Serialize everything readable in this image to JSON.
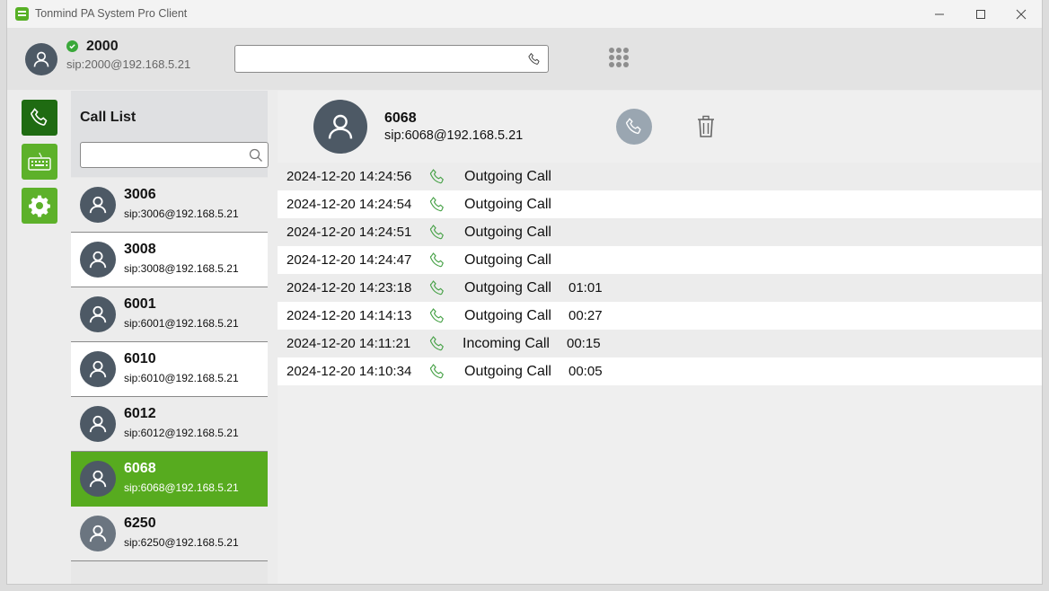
{
  "window": {
    "title": "Tonmind PA System Pro Client"
  },
  "header": {
    "user_name": "2000",
    "user_sip": "sip:2000@192.168.5.21",
    "dial_placeholder": ""
  },
  "call_list": {
    "title": "Call List",
    "search_placeholder": "",
    "contacts": [
      {
        "name": "3006",
        "sip": "sip:3006@192.168.5.21"
      },
      {
        "name": "3008",
        "sip": "sip:3008@192.168.5.21"
      },
      {
        "name": "6001",
        "sip": "sip:6001@192.168.5.21"
      },
      {
        "name": "6010",
        "sip": "sip:6010@192.168.5.21"
      },
      {
        "name": "6012",
        "sip": "sip:6012@192.168.5.21"
      },
      {
        "name": "6068",
        "sip": "sip:6068@192.168.5.21"
      },
      {
        "name": "6250",
        "sip": "sip:6250@192.168.5.21"
      }
    ]
  },
  "detail": {
    "name": "6068",
    "sip": "sip:6068@192.168.5.21",
    "history": [
      {
        "date": "2024-12-20 14:24:56",
        "type": "Outgoing Call",
        "duration": ""
      },
      {
        "date": "2024-12-20 14:24:54",
        "type": "Outgoing Call",
        "duration": ""
      },
      {
        "date": "2024-12-20 14:24:51",
        "type": "Outgoing Call",
        "duration": ""
      },
      {
        "date": "2024-12-20 14:24:47",
        "type": "Outgoing Call",
        "duration": ""
      },
      {
        "date": "2024-12-20 14:23:18",
        "type": "Outgoing Call",
        "duration": "01:01"
      },
      {
        "date": "2024-12-20 14:14:13",
        "type": "Outgoing Call",
        "duration": "00:27"
      },
      {
        "date": "2024-12-20 14:11:21",
        "type": "Incoming Call",
        "duration": "00:15"
      },
      {
        "date": "2024-12-20 14:10:34",
        "type": "Outgoing Call",
        "duration": "00:05"
      }
    ]
  },
  "colors": {
    "accent": "#57ab1f",
    "nav_active": "#1f6b12",
    "avatar": "#4d5965",
    "call_icon": "#4aa34a"
  },
  "icons": {
    "app": "app-logo-icon",
    "nav": [
      "phone-icon",
      "keyboard-icon",
      "gear-icon"
    ],
    "keypad": "keypad-icon",
    "delete": "trash-icon"
  }
}
